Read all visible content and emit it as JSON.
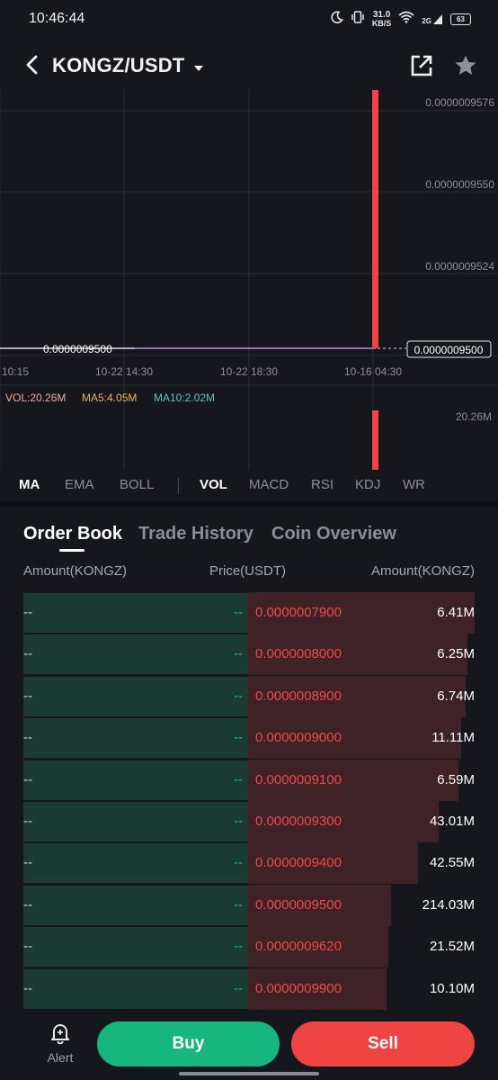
{
  "status": {
    "time": "10:46:44",
    "net_speed": "31.0",
    "net_unit": "KB/S",
    "signal": "2G",
    "battery": "63"
  },
  "header": {
    "title": "KONGZ/USDT"
  },
  "chart_data": {
    "type": "candlestick",
    "price_axis_labels": [
      "0.0000009576",
      "0.0000009550",
      "0.0000009524"
    ],
    "time_axis_labels": [
      "10:15",
      "10-22 14:30",
      "10-22 18:30",
      "10-16 04:30"
    ],
    "last_price_left": "0.0000009500",
    "last_price_tag": "0.0000009500",
    "ma_line_value": 9.5e-07,
    "candle": {
      "low": 9.5e-07,
      "high": 9.576e-07,
      "color": "#ef4444"
    },
    "volume": {
      "label": "VOL:20.26M",
      "ma5": "MA5:4.05M",
      "ma10": "MA10:2.02M",
      "axis_max": "20.26M",
      "bar_value": 20.26
    },
    "colors": {
      "vol": "#f0a8a0",
      "ma5": "#e8b45a",
      "ma10": "#52c8c0",
      "ma_line": "#b98be0"
    }
  },
  "indicator_tabs": {
    "main": [
      "MA",
      "EMA",
      "BOLL"
    ],
    "sub": [
      "VOL",
      "MACD",
      "RSI",
      "KDJ",
      "WR"
    ],
    "active_main": "MA",
    "active_sub": "VOL"
  },
  "order_book": {
    "tabs": [
      "Order Book",
      "Trade History",
      "Coin Overview"
    ],
    "header": {
      "left": "Amount(KONGZ)",
      "mid": "Price(USDT)",
      "right": "Amount(KONGZ)"
    },
    "rows": [
      {
        "bid_amount": "--",
        "bid_price": "--",
        "ask_price": "0.0000007900",
        "ask_amount": "6.41M",
        "depth": 1.0
      },
      {
        "bid_amount": "--",
        "bid_price": "--",
        "ask_price": "0.0000008000",
        "ask_amount": "6.25M",
        "depth": 0.97
      },
      {
        "bid_amount": "--",
        "bid_price": "--",
        "ask_price": "0.0000008900",
        "ask_amount": "6.74M",
        "depth": 0.96
      },
      {
        "bid_amount": "--",
        "bid_price": "--",
        "ask_price": "0.0000009000",
        "ask_amount": "11.11M",
        "depth": 0.94
      },
      {
        "bid_amount": "--",
        "bid_price": "--",
        "ask_price": "0.0000009100",
        "ask_amount": "6.59M",
        "depth": 0.93
      },
      {
        "bid_amount": "--",
        "bid_price": "--",
        "ask_price": "0.0000009300",
        "ask_amount": "43.01M",
        "depth": 0.84
      },
      {
        "bid_amount": "--",
        "bid_price": "--",
        "ask_price": "0.0000009400",
        "ask_amount": "42.55M",
        "depth": 0.75
      },
      {
        "bid_amount": "--",
        "bid_price": "--",
        "ask_price": "0.0000009500",
        "ask_amount": "214.03M",
        "depth": 0.63
      },
      {
        "bid_amount": "--",
        "bid_price": "--",
        "ask_price": "0.0000009620",
        "ask_amount": "21.52M",
        "depth": 0.62
      },
      {
        "bid_amount": "--",
        "bid_price": "--",
        "ask_price": "0.0000009900",
        "ask_amount": "10.10M",
        "depth": 0.61
      }
    ]
  },
  "bottom": {
    "alert_label": "Alert",
    "buy_label": "Buy",
    "sell_label": "Sell"
  }
}
